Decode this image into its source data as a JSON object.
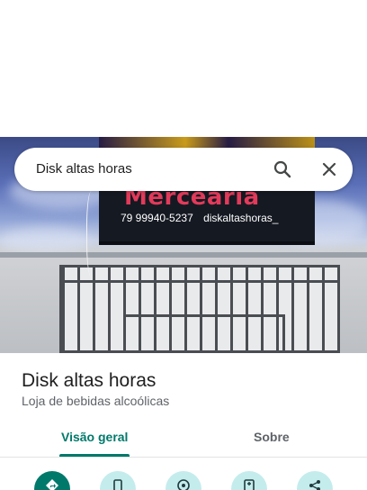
{
  "search": {
    "value": "Disk altas horas"
  },
  "photo": {
    "sign_title": "Mercearia",
    "sign_phone": "79 99940-5237",
    "sign_instagram": "diskaltashoras_"
  },
  "place": {
    "name": "Disk altas horas",
    "category": "Loja de bebidas alcoólicas"
  },
  "tabs": [
    {
      "label": "Visão geral",
      "selected": true
    },
    {
      "label": "Sobre",
      "selected": false
    }
  ],
  "actions": [
    {
      "icon": "directions-icon"
    },
    {
      "icon": "phone-icon"
    },
    {
      "icon": "save-icon"
    },
    {
      "icon": "send-to-phone-icon"
    },
    {
      "icon": "share-icon"
    }
  ],
  "colors": {
    "accent": "#00796b",
    "action_bg": "#c4eced"
  }
}
